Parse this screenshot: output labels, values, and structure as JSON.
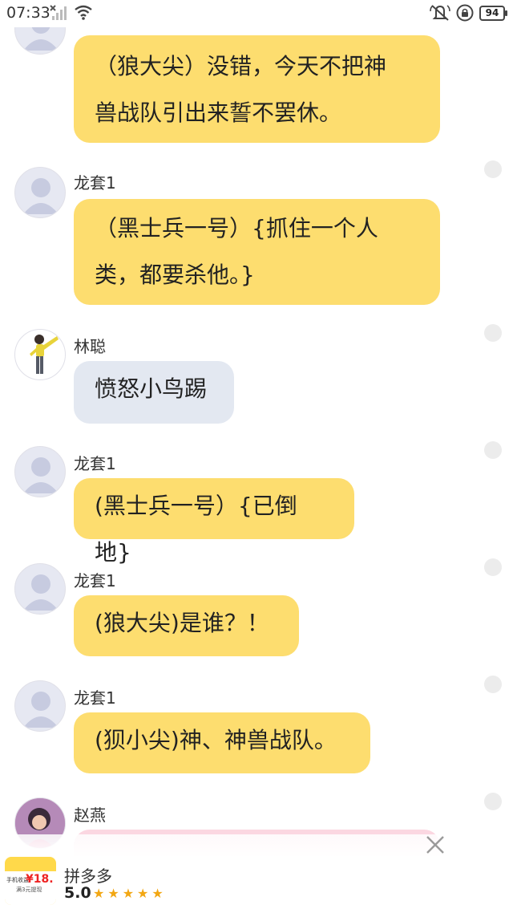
{
  "status_bar": {
    "time": "07:33",
    "battery": "94",
    "icons": [
      "sim-no-signal-icon",
      "wifi-icon",
      "mute-icon",
      "rotation-lock-icon",
      "battery-icon"
    ]
  },
  "messages": [
    {
      "nickname": "",
      "avatar": "default-avatar",
      "lines": [
        "（狼大尖）没错，今天不把神",
        "兽战队引出来誓不罢休。"
      ],
      "bubble_color": "#fddd6f"
    },
    {
      "nickname": "龙套1",
      "avatar": "default-avatar",
      "lines": [
        "（黑士兵一号）{抓住一个人",
        "类，都要杀他。}"
      ],
      "bubble_color": "#fddd6f"
    },
    {
      "nickname": "林聪",
      "avatar": "character-avatar-yellow-jacket",
      "lines": [
        "愤怒小鸟踢"
      ],
      "bubble_color": "#e3e8f1"
    },
    {
      "nickname": "龙套1",
      "avatar": "default-avatar",
      "lines": [
        "(黑士兵一号）{已倒地}"
      ],
      "bubble_color": "#fddd6f"
    },
    {
      "nickname": "龙套1",
      "avatar": "default-avatar",
      "lines": [
        "(狼大尖)是谁？！"
      ],
      "bubble_color": "#fddd6f"
    },
    {
      "nickname": "龙套1",
      "avatar": "default-avatar",
      "lines": [
        "(狈小尖)神、神兽战队。"
      ],
      "bubble_color": "#fddd6f"
    },
    {
      "nickname": "赵燕",
      "avatar": "character-avatar-pink",
      "lines": [
        ""
      ],
      "bubble_color": "#fbd7e1"
    }
  ],
  "ad": {
    "app_name": "拼多多",
    "rating": "5.0",
    "stars": "★★★★★",
    "thumb_price": "¥18.",
    "thumb_text_1": "手机收益",
    "thumb_text_2": "满3元提现",
    "close_icon": "close-icon"
  }
}
